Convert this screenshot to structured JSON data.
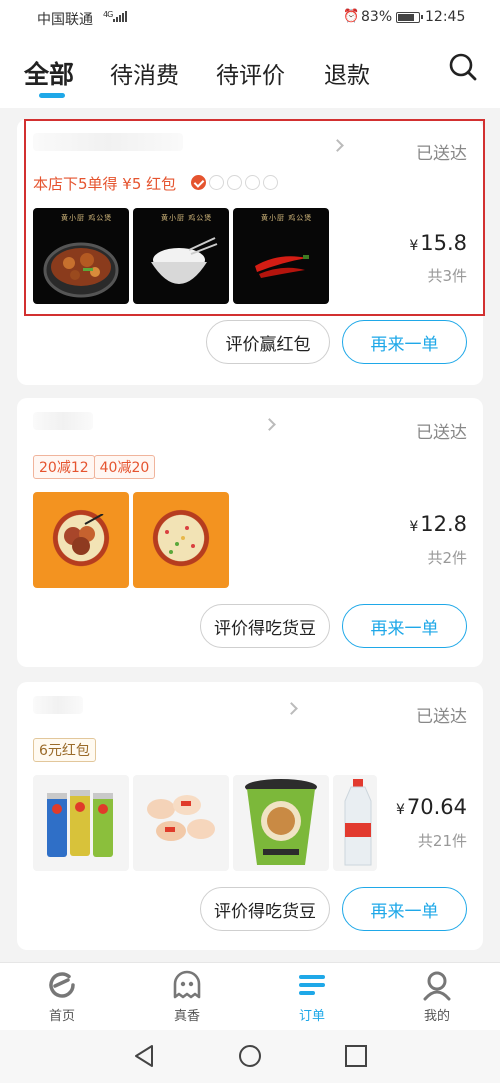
{
  "status_bar": {
    "carrier": "中国联通",
    "signal_type": "4G",
    "battery_percent": "83%",
    "battery_level": 0.83,
    "time": "12:45",
    "icons": [
      "alarm-icon",
      "battery-icon",
      "signal-bars-icon"
    ]
  },
  "tabs": [
    {
      "label": "全部",
      "active": true
    },
    {
      "label": "待消费",
      "active": false
    },
    {
      "label": "待评价",
      "active": false
    },
    {
      "label": "退款",
      "active": false
    }
  ],
  "accent_color": "#1fa8e8",
  "promo_color": "#e5542f",
  "orders": [
    {
      "status": "已送达",
      "promo_text": "本店下5单得 ¥5 红包",
      "promo_progress": {
        "completed": 1,
        "total": 5
      },
      "currency": "¥",
      "price": "15.8",
      "item_count": "共3件",
      "review_button": "评价赢红包",
      "reorder_button": "再来一单"
    },
    {
      "status": "已送达",
      "tags": [
        "20减12",
        "40减20"
      ],
      "currency": "¥",
      "price": "12.8",
      "item_count": "共2件",
      "review_button": "评价得吃货豆",
      "reorder_button": "再来一单"
    },
    {
      "status": "已送达",
      "tags": [
        "6元红包"
      ],
      "currency": "¥",
      "price": "70.64",
      "item_count": "共21件",
      "review_button": "评价得吃货豆",
      "reorder_button": "再来一单"
    }
  ],
  "bottom_nav": [
    {
      "label": "首页",
      "icon": "home-icon",
      "active": false
    },
    {
      "label": "真香",
      "icon": "ghost-icon",
      "active": false
    },
    {
      "label": "订单",
      "icon": "order-list-icon",
      "active": true
    },
    {
      "label": "我的",
      "icon": "profile-icon",
      "active": false
    }
  ]
}
